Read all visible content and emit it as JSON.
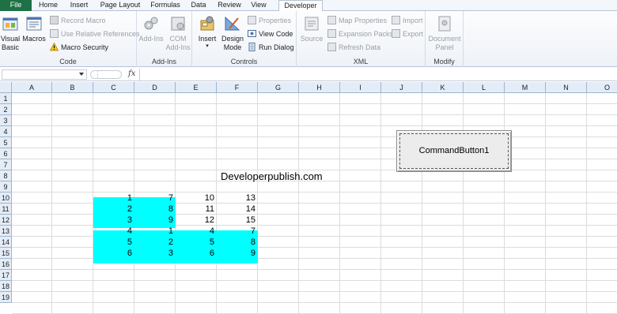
{
  "tabs": [
    "File",
    "Home",
    "Insert",
    "Page Layout",
    "Formulas",
    "Data",
    "Review",
    "View",
    "Developer"
  ],
  "active_tab": "Developer",
  "ribbon": {
    "code": {
      "label": "Code",
      "visual_basic": "Visual\nBasic",
      "macros": "Macros",
      "record_macro": "Record Macro",
      "use_relative": "Use Relative References",
      "macro_security": "Macro Security"
    },
    "addins": {
      "label": "Add-Ins",
      "addins_btn": "Add-Ins",
      "com_addins": "COM\nAdd-Ins"
    },
    "controls": {
      "label": "Controls",
      "insert": "Insert",
      "design_mode": "Design\nMode",
      "properties": "Properties",
      "view_code": "View Code",
      "run_dialog": "Run Dialog"
    },
    "xml": {
      "label": "XML",
      "source": "Source",
      "map_properties": "Map Properties",
      "expansion_packs": "Expansion Packs",
      "refresh_data": "Refresh Data",
      "import": "Import",
      "export": "Export"
    },
    "modify": {
      "label": "Modify",
      "document_panel": "Document\nPanel"
    }
  },
  "formula_bar": {
    "name_box": "",
    "fx": "fx",
    "formula": ""
  },
  "columns": [
    "A",
    "B",
    "C",
    "D",
    "E",
    "F",
    "G",
    "H",
    "I",
    "J",
    "K",
    "L",
    "M",
    "N",
    "O"
  ],
  "rows": [
    "1",
    "2",
    "3",
    "4",
    "5",
    "6",
    "7",
    "8",
    "9",
    "10",
    "11",
    "12",
    "13",
    "14",
    "15",
    "16",
    "17",
    "18",
    "19"
  ],
  "sheet": {
    "text_e8": "Developerpublish.com",
    "command_button": "CommandButton1",
    "highlight_color": "#00ffff",
    "values": {
      "C": [
        "1",
        "2",
        "3",
        "4",
        "5",
        "6"
      ],
      "D": [
        "7",
        "8",
        "9",
        "1",
        "2",
        "3"
      ],
      "E": [
        "10",
        "11",
        "12",
        "4",
        "5",
        "6"
      ],
      "F": [
        "13",
        "14",
        "15",
        "7",
        "8",
        "9"
      ]
    }
  }
}
